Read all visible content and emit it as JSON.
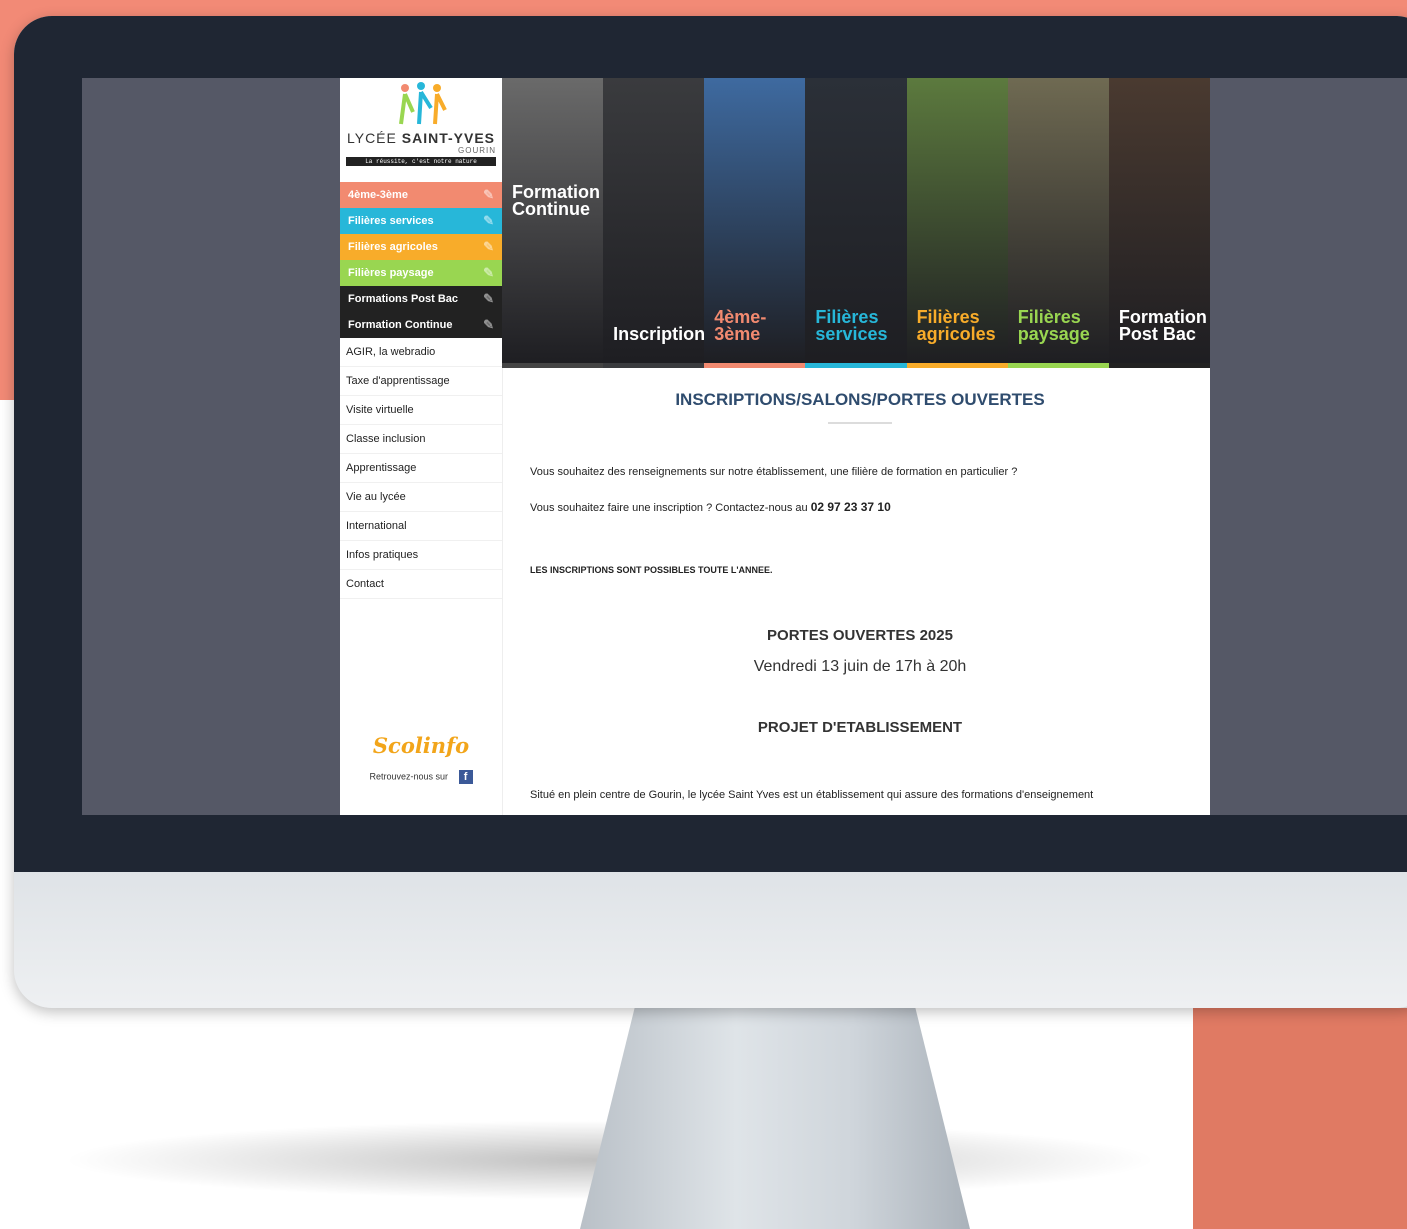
{
  "logo": {
    "name_light": "LYCÉE",
    "name_bold": "SAINT-YVES",
    "town": "GOURIN",
    "tagline": "La réussite, c'est notre nature"
  },
  "sidebar": {
    "colored_items": [
      {
        "label": "4ème-3ème",
        "color": "#f28a70"
      },
      {
        "label": "Filières services",
        "color": "#27b7d9"
      },
      {
        "label": "Filières agricoles",
        "color": "#f8ac2a"
      },
      {
        "label": "Filières paysage",
        "color": "#99d651"
      },
      {
        "label": "Formations Post Bac",
        "color": "#222222"
      },
      {
        "label": "Formation Continue",
        "color": "#222222"
      }
    ],
    "plain_items": [
      {
        "label": "AGIR, la webradio"
      },
      {
        "label": "Taxe d'apprentissage"
      },
      {
        "label": "Visite virtuelle"
      },
      {
        "label": "Classe inclusion"
      },
      {
        "label": "Apprentissage"
      },
      {
        "label": "Vie au lycée"
      },
      {
        "label": "International"
      },
      {
        "label": "Infos pratiques"
      },
      {
        "label": "Contact"
      }
    ],
    "scolinfo": "Scolinfo",
    "follow_text": "Retrouvez-nous sur",
    "facebook_icon": "f"
  },
  "banner": [
    {
      "label": "Formation Continue",
      "bg": "#6a6a6a",
      "text_color": "#ffffff",
      "accent": "#444444",
      "position": "top"
    },
    {
      "label": "Inscription",
      "bg": "#3a3b3e",
      "text_color": "#ffffff",
      "accent": "#3a3b3e",
      "position": "bottom"
    },
    {
      "label": "4ème-3ème",
      "bg": "#3e6aa0",
      "text_color": "#f28a70",
      "accent": "#f28a70",
      "position": "bottom"
    },
    {
      "label": "Filières services",
      "bg": "#2b3038",
      "text_color": "#27b7d9",
      "accent": "#27b7d9",
      "position": "bottom"
    },
    {
      "label": "Filières agricoles",
      "bg": "#5c7a3e",
      "text_color": "#f8ac2a",
      "accent": "#f8ac2a",
      "position": "bottom"
    },
    {
      "label": "Filières paysage",
      "bg": "#6f6a52",
      "text_color": "#99d651",
      "accent": "#99d651",
      "position": "bottom"
    },
    {
      "label": "Formation Post Bac",
      "bg": "#4a3a30",
      "text_color": "#ffffff",
      "accent": "#222222",
      "position": "bottom"
    }
  ],
  "content": {
    "title": "INSCRIPTIONS/SALONS/PORTES OUVERTES",
    "para1": "Vous souhaitez des renseignements sur notre établissement, une filière de formation  en particulier ?",
    "para2_text": "Vous souhaitez faire une inscription ? Contactez-nous au",
    "phone": "02 97 23 37 10",
    "para3": "LES INSCRIPTIONS SONT POSSIBLES TOUTE L'ANNEE.",
    "po_title": "PORTES OUVERTES 2025",
    "po_date": "Vendredi 13 juin de 17h à 20h",
    "pe_title": "PROJET D'ETABLISSEMENT",
    "last_para": "Situé en plein centre de Gourin, le lycée Saint Yves est un établissement qui assure des formations d'enseignement"
  }
}
